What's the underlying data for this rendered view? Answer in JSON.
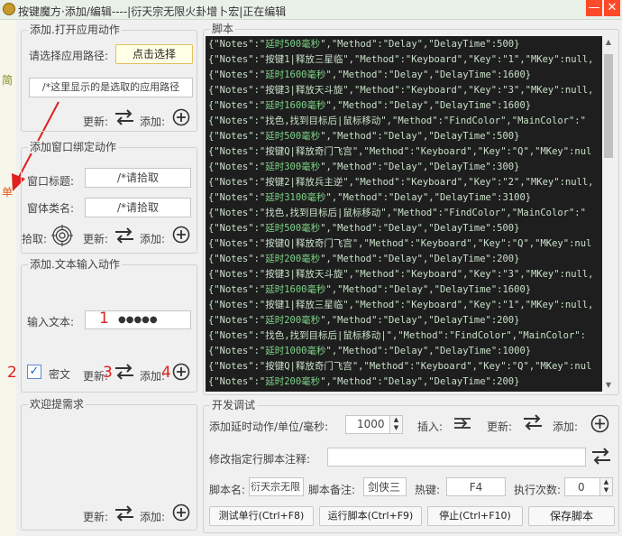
{
  "window": {
    "title": "按键魔方·添加/编辑----|衍天宗无限火卦增卜宏|正在编辑",
    "minimize": "—",
    "close": "✕"
  },
  "side": {
    "char1": "简",
    "char2": "单"
  },
  "annotations": {
    "n1": "1",
    "n2": "2",
    "n3": "3",
    "n4": "4"
  },
  "open_app": {
    "title": "添加.打开应用动作",
    "path_label": "请选择应用路径:",
    "choose_button": "点击选择",
    "path_value": "/*这里显示的是选取的应用路径",
    "update_label": "更新:",
    "add_label": "添加:"
  },
  "bind_window": {
    "title": "添加窗口绑定动作",
    "window_title_label": "窗口标题:",
    "window_title_value": "/*请拾取",
    "class_label": "窗体类名:",
    "class_value": "/*请拾取",
    "pick_label": "拾取:",
    "update_label": "更新:",
    "add_label": "添加:"
  },
  "text_input": {
    "title": "添加.文本输入动作",
    "input_label": "输入文本:",
    "input_value": "●●●●●",
    "password_checkbox_label": "密文",
    "password_checked": true,
    "update_label": "更新:",
    "add_label": "添加:"
  },
  "request": {
    "title": "欢迎提需求",
    "update_label": "更新:",
    "add_label": "添加:"
  },
  "script": {
    "title": "脚本",
    "lines": [
      {
        "a": "{\"Notes\":\"",
        "b": "延时500毫秒",
        "c": "\",\"Method\":\"Delay\",\"DelayTime\":500}"
      },
      {
        "a": "{\"Notes\":\"按键1|释放三星临\",\"Method\":\"Keyboard\",\"Key\":\"1\",\"MKey\":null,",
        "b": "",
        "c": ""
      },
      {
        "a": "{\"Notes\":\"",
        "b": "延时1600毫秒",
        "c": "\",\"Method\":\"Delay\",\"DelayTime\":1600}"
      },
      {
        "a": "{\"Notes\":\"按键3|释放天斗旋\",\"Method\":\"Keyboard\",\"Key\":\"3\",\"MKey\":null,",
        "b": "",
        "c": ""
      },
      {
        "a": "{\"Notes\":\"",
        "b": "延时1600毫秒",
        "c": "\",\"Method\":\"Delay\",\"DelayTime\":1600}"
      },
      {
        "a": "{\"Notes\":\"找色,找到目标后|鼠标移动\",\"Method\":\"FindColor\",\"MainColor\":\"",
        "b": "",
        "c": ""
      },
      {
        "a": "{\"Notes\":\"",
        "b": "延时500毫秒",
        "c": "\",\"Method\":\"Delay\",\"DelayTime\":500}"
      },
      {
        "a": "{\"Notes\":\"按键Q|释放奇门飞宫\",\"Method\":\"Keyboard\",\"Key\":\"Q\",\"MKey\":nul",
        "b": "",
        "c": ""
      },
      {
        "a": "{\"Notes\":\"",
        "b": "延时300毫秒",
        "c": "\",\"Method\":\"Delay\",\"DelayTime\":300}"
      },
      {
        "a": "{\"Notes\":\"按键2|释放兵主逆\",\"Method\":\"Keyboard\",\"Key\":\"2\",\"MKey\":null,",
        "b": "",
        "c": ""
      },
      {
        "a": "{\"Notes\":\"",
        "b": "延时3100毫秒",
        "c": "\",\"Method\":\"Delay\",\"DelayTime\":3100}"
      },
      {
        "a": "{\"Notes\":\"找色,找到目标后|鼠标移动\",\"Method\":\"FindColor\",\"MainColor\":\"",
        "b": "",
        "c": ""
      },
      {
        "a": "{\"Notes\":\"",
        "b": "延时500毫秒",
        "c": "\",\"Method\":\"Delay\",\"DelayTime\":500}"
      },
      {
        "a": "{\"Notes\":\"按键Q|释放奇门飞宫\",\"Method\":\"Keyboard\",\"Key\":\"Q\",\"MKey\":nul",
        "b": "",
        "c": ""
      },
      {
        "a": "{\"Notes\":\"",
        "b": "延时200毫秒",
        "c": "\",\"Method\":\"Delay\",\"DelayTime\":200}"
      },
      {
        "a": "{\"Notes\":\"按键3|释放天斗旋\",\"Method\":\"Keyboard\",\"Key\":\"3\",\"MKey\":null,",
        "b": "",
        "c": ""
      },
      {
        "a": "{\"Notes\":\"",
        "b": "延时1600毫秒",
        "c": "\",\"Method\":\"Delay\",\"DelayTime\":1600}"
      },
      {
        "a": "{\"Notes\":\"按键1|释放三星临\",\"Method\":\"Keyboard\",\"Key\":\"1\",\"MKey\":null,",
        "b": "",
        "c": ""
      },
      {
        "a": "{\"Notes\":\"",
        "b": "延时200毫秒",
        "c": "\",\"Method\":\"Delay\",\"DelayTime\":200}"
      },
      {
        "a": "{\"Notes\":\"找色,找到目标后|鼠标移动|\",\"Method\":\"FindColor\",\"MainColor\":",
        "b": "",
        "c": ""
      },
      {
        "a": "{\"Notes\":\"",
        "b": "延时1000毫秒",
        "c": "\",\"Method\":\"Delay\",\"DelayTime\":1000}"
      },
      {
        "a": "{\"Notes\":\"按键Q|释放奇门飞宫\",\"Method\":\"Keyboard\",\"Key\":\"Q\",\"MKey\":nul",
        "b": "",
        "c": ""
      },
      {
        "a": "{\"Notes\":\"",
        "b": "延时200毫秒",
        "c": "\",\"Method\":\"Delay\",\"DelayTime\":200}"
      }
    ]
  },
  "dev": {
    "title": "开发调试",
    "delay_label": "添加延时动作/单位/毫秒:",
    "delay_value": "1000",
    "insert_label": "插入:",
    "update_label": "更新:",
    "add_label": "添加:",
    "modify_note_label": "修改指定行脚本注释:",
    "modify_note_value": "",
    "script_name_label": "脚本名:",
    "script_name_value": "衍天宗无限",
    "script_note_label": "脚本备注:",
    "script_note_value": "剑侠三",
    "hotkey_label": "热键:",
    "hotkey_value": "F4",
    "exec_count_label": "执行次数:",
    "exec_count_value": "0",
    "test_button": "测试单行(Ctrl+F8)",
    "run_button": "运行脚本(Ctrl+F9)",
    "stop_button": "停止(Ctrl+F10)",
    "save_button": "保存脚本"
  },
  "colors": {
    "accent": "#e02020",
    "editor_bg": "#1e1e1e",
    "editor_text": "#c8e0c8",
    "editor_highlight": "#7fd48a",
    "close_red": "#ff4a2a"
  }
}
